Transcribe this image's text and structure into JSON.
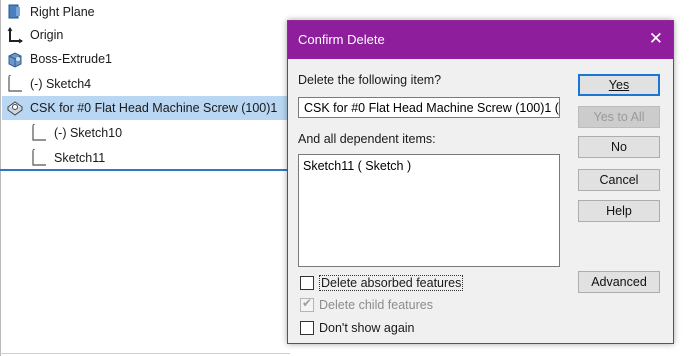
{
  "tree": {
    "items": [
      {
        "label": "Right Plane",
        "icon": "plane-icon"
      },
      {
        "label": "Origin",
        "icon": "origin-icon"
      },
      {
        "label": "Boss-Extrude1",
        "icon": "extrude-icon"
      },
      {
        "label": "(-) Sketch4",
        "icon": "sketch-icon"
      },
      {
        "label": "CSK for #0 Flat Head Machine Screw (100)1",
        "icon": "hole-wizard-icon"
      },
      {
        "label": "(-) Sketch10",
        "icon": "sketch-icon"
      },
      {
        "label": "Sketch11",
        "icon": "sketch-icon"
      }
    ]
  },
  "dialog": {
    "title": "Confirm Delete",
    "close_glyph": "✕",
    "delete_item_label": "Delete the following item?",
    "delete_item_value": "CSK for #0 Flat Head Machine Screw (100)1 (",
    "dependent_label": "And all dependent items:",
    "dependent_items": [
      "Sketch11 ( Sketch )"
    ],
    "buttons": {
      "yes": "Yes",
      "yes_to_all": "Yes to All",
      "no": "No",
      "cancel": "Cancel",
      "help": "Help",
      "advanced": "Advanced"
    },
    "checkboxes": {
      "absorbed": "Delete absorbed features",
      "child": "Delete child features",
      "dont_show": "Don't show again"
    }
  },
  "colors": {
    "titlebar": "#8e1e9c",
    "selection": "#b9d7f2",
    "default_button_border": "#1a78d4"
  }
}
